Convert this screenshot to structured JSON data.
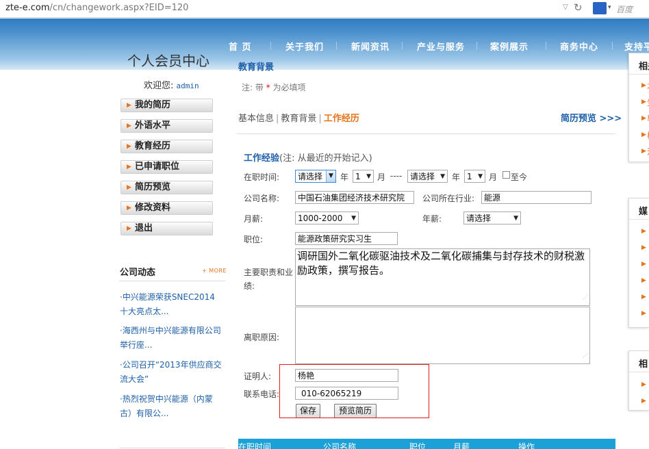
{
  "browser": {
    "url_host": "zte-e.com",
    "url_path": "/cn/changework.aspx?EID=120",
    "search_placeholder": "百度"
  },
  "nav": [
    "首 页",
    "关于我们",
    "新闻资讯",
    "产业与服务",
    "案例展示",
    "商务中心",
    "支持平"
  ],
  "sidebar": {
    "title": "个人会员中心",
    "welcome_label": "欢迎您:",
    "username": "admin",
    "menu": [
      "我的简历",
      "外语水平",
      "教育经历",
      "已申请职位",
      "简历预览",
      "修改资料",
      "退出"
    ]
  },
  "news": {
    "title": "公司动态",
    "more": "+ MORE",
    "items": [
      "·中兴能源荣获SNEC2014十大亮点太...",
      "·海西州与中兴能源有限公司举行座...",
      "·公司召开“2013年供应商交流大会”",
      "·热烈祝贺中兴能源（内蒙古）有限公..."
    ]
  },
  "main": {
    "section_title": "教育背景",
    "note_prefix": "注: 带",
    "note_star": "*",
    "note_suffix": "为必填项",
    "tabs": [
      "基本信息",
      "教育背景",
      "工作经历"
    ],
    "preview_link": "简历预览 >>>",
    "work_title": "工作经验",
    "work_note": "(注: 从最近的开始记入)"
  },
  "form": {
    "period_label": "在职时间:",
    "start_year": "请选择",
    "year_unit": "年",
    "start_month": "1",
    "month_unit": "月",
    "dash": "----",
    "end_year": "请选择",
    "end_month": "1",
    "until_now": "至今",
    "company_label": "公司名称:",
    "company_value": "中国石油集团经济技术研究院",
    "industry_label": "公司所在行业:",
    "industry_value": "能源",
    "monthly_label": "月薪:",
    "monthly_value": "1000-2000",
    "annual_label": "年薪:",
    "annual_value": "请选择",
    "position_label": "职位:",
    "position_value": "能源政策研究实习生",
    "duties_label": "主要职责和业绩:",
    "duties_value": "调研国外二氧化碳驱油技术及二氧化碳捕集与封存技术的财税激励政策，撰写报告。",
    "leave_label": "离职原因:",
    "leave_value": "",
    "reference_label": "证明人:",
    "reference_value": "杨艳",
    "phone_label": "联系电话:",
    "phone_value": "010-62065219",
    "save_button": "保存",
    "preview_button": "预览简历"
  },
  "table_header": [
    "在职时间",
    "公司名称",
    "职位",
    "月薪",
    "操作"
  ],
  "right_sidebar": {
    "box1_title": "相关",
    "box1_items": [
      "才",
      "生",
      "毕",
      "校",
      "法"
    ],
    "box2_title": "媒",
    "box3_title": "相"
  },
  "colors": {
    "link_blue": "#1d5fa8",
    "accent_orange": "#e8731b",
    "table_header_blue": "#1ba1d8",
    "highlight_red": "#e31c1c"
  }
}
